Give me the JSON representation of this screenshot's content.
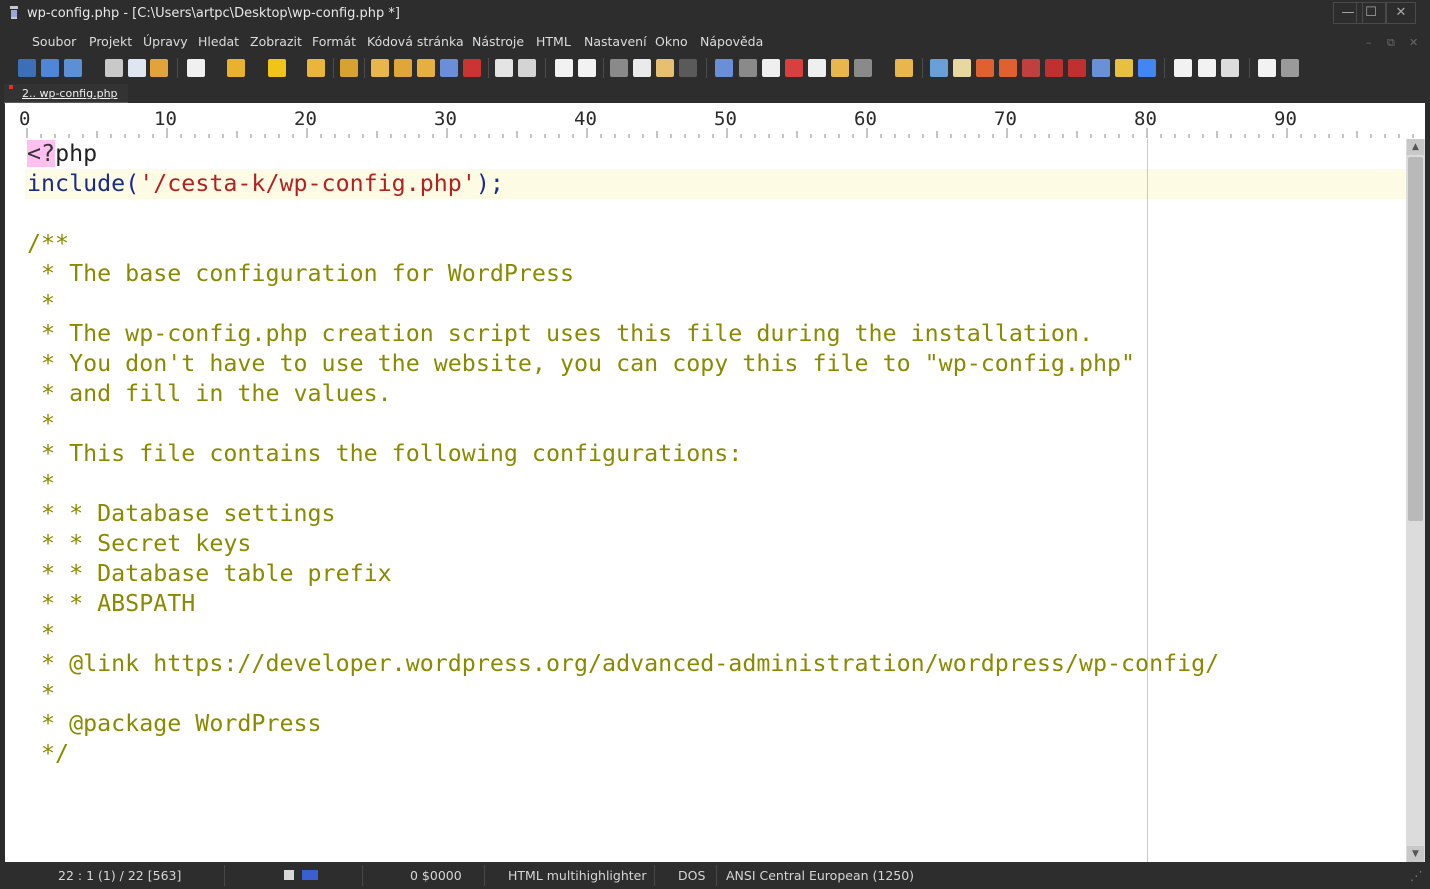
{
  "window": {
    "title": "wp-config.php - [C:\\Users\\artpc\\Desktop\\wp-config.php *]",
    "minimize": "—",
    "maximize": "☐",
    "close": "✕"
  },
  "menu": [
    "Soubor",
    "Projekt",
    "Úpravy",
    "Hledat",
    "Zobrazit",
    "Formát",
    "Kódová stránka",
    "Nástroje",
    "HTML",
    "Nastavení",
    "Okno",
    "Nápověda"
  ],
  "mdi": {
    "minimize": "–",
    "restore": "⧉",
    "close": "✕"
  },
  "tab": {
    "label": "2.. wp-config.php"
  },
  "ruler": [
    "0",
    "10",
    "20",
    "30",
    "40",
    "50",
    "60",
    "70",
    "80",
    "90"
  ],
  "code_lines": [
    [
      {
        "t": "<?",
        "s": "php-tag"
      },
      {
        "t": "php",
        "s": "plain"
      }
    ],
    [
      {
        "t": "include",
        "s": "kw"
      },
      {
        "t": "(",
        "s": "kw"
      },
      {
        "t": "'/cesta-k/wp-config.php'",
        "s": "str"
      },
      {
        "t": ");",
        "s": "kw"
      }
    ],
    [],
    [
      {
        "t": "/**",
        "s": "cmt"
      }
    ],
    [
      {
        "t": " * The base configuration for WordPress",
        "s": "cmt"
      }
    ],
    [
      {
        "t": " *",
        "s": "cmt"
      }
    ],
    [
      {
        "t": " * The wp-config.php creation script uses this file during the installation.",
        "s": "cmt"
      }
    ],
    [
      {
        "t": " * You don't have to use the website, you can copy this file to \"wp-config.php\"",
        "s": "cmt"
      }
    ],
    [
      {
        "t": " * and fill in the values.",
        "s": "cmt"
      }
    ],
    [
      {
        "t": " *",
        "s": "cmt"
      }
    ],
    [
      {
        "t": " * This file contains the following configurations:",
        "s": "cmt"
      }
    ],
    [
      {
        "t": " *",
        "s": "cmt"
      }
    ],
    [
      {
        "t": " * * Database settings",
        "s": "cmt"
      }
    ],
    [
      {
        "t": " * * Secret keys",
        "s": "cmt"
      }
    ],
    [
      {
        "t": " * * Database table prefix",
        "s": "cmt"
      }
    ],
    [
      {
        "t": " * * ABSPATH",
        "s": "cmt"
      }
    ],
    [
      {
        "t": " *",
        "s": "cmt"
      }
    ],
    [
      {
        "t": " * @link https://developer.wordpress.org/advanced-administration/wordpress/wp-config/",
        "s": "cmt"
      }
    ],
    [
      {
        "t": " *",
        "s": "cmt"
      }
    ],
    [
      {
        "t": " * @package WordPress",
        "s": "cmt"
      }
    ],
    [
      {
        "t": " */",
        "s": "cmt"
      }
    ]
  ],
  "status": {
    "position": "22 : 1 (1) / 22  [563]",
    "offset": "0  $0000",
    "highlighter": "HTML multihighlighter",
    "line_endings": "DOS",
    "encoding": "ANSI Central European (1250)"
  },
  "colors": {
    "keyword": "#1b2b8a",
    "string": "#b22222",
    "comment": "#8a8a00",
    "php_tag_bg": "#ffc0f0",
    "current_line": "#fdfbe3"
  }
}
